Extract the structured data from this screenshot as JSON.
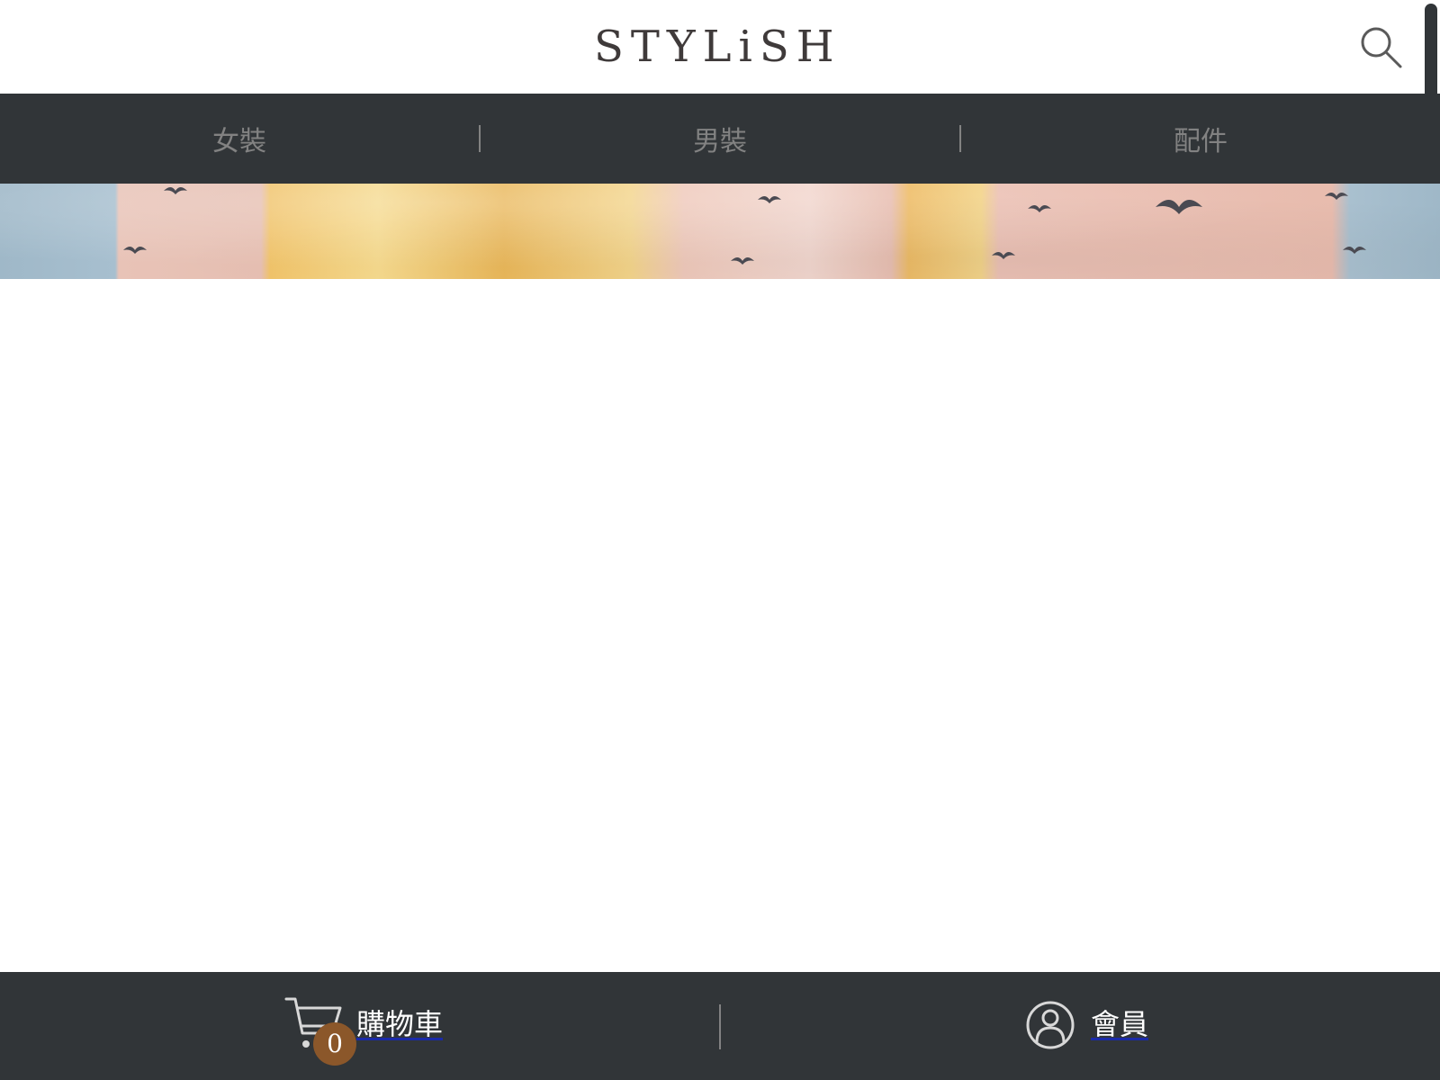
{
  "header": {
    "logo_text": "STYLiSH",
    "search_icon": "search-icon"
  },
  "nav": {
    "items": [
      {
        "label": "女裝"
      },
      {
        "label": "男裝"
      },
      {
        "label": "配件"
      }
    ]
  },
  "hero": {
    "image": "hero-banner-image"
  },
  "bottom_bar": {
    "cart": {
      "label": "購物車",
      "count": "0",
      "icon": "cart-icon"
    },
    "member": {
      "label": "會員",
      "icon": "member-icon"
    }
  },
  "colors": {
    "header_bg": "#ffffff",
    "bar_bg": "#313538",
    "nav_text": "#828282",
    "logo_text": "#3f3a3a",
    "badge_bg": "#8b572a",
    "bottom_text": "#ffffff"
  }
}
